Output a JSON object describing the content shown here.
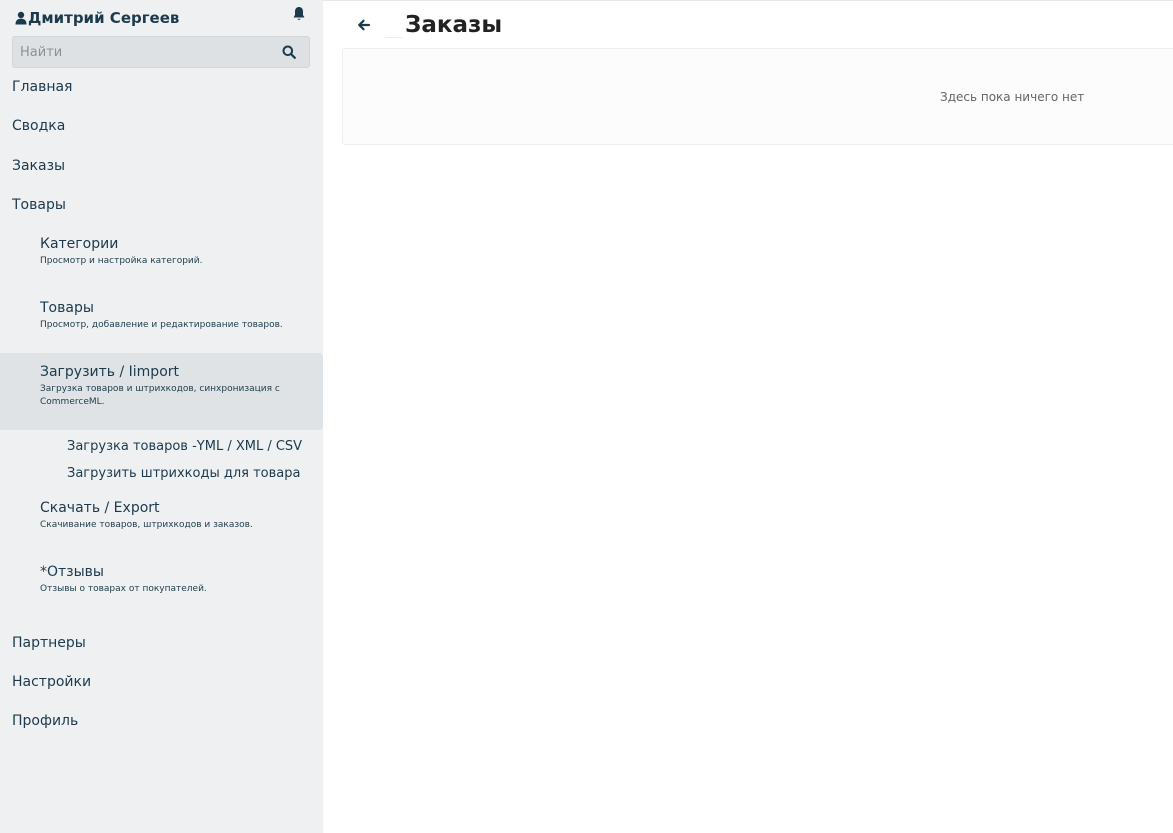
{
  "user": {
    "name": "Дмитрий Сергеев",
    "icon": "user-icon"
  },
  "notifications": {
    "icon": "bell-icon"
  },
  "search": {
    "placeholder": "Найти",
    "value": "",
    "icon": "search-icon"
  },
  "nav": {
    "home": "Главная",
    "summary": "Сводка",
    "orders": "Заказы",
    "products": "Товары",
    "partners": "Партнеры",
    "settings": "Настройки",
    "profile": "Профиль"
  },
  "products_menu": {
    "categories": {
      "title": "Категории",
      "desc": "Просмотр и настройка категорий."
    },
    "goods": {
      "title": "Товары",
      "desc": "Просмотр, добавление и редактирование товаров."
    },
    "import": {
      "title": "Загрузить / Iimport",
      "desc": "Загрузка товаров и штрихкодов, синхронизация с CommerceML."
    },
    "import_sub": {
      "yml": "Загрузка товаров -YML / XML / CSV",
      "barcodes": "Загрузить штрихкоды для товара"
    },
    "export": {
      "title": "Скачать / Export",
      "desc": "Скачивание товаров, штрихкодов и заказов."
    },
    "reviews": {
      "title": "*Отзывы",
      "desc": "Отзывы о товарах от покупателей."
    }
  },
  "main": {
    "back_icon": "arrow-left-icon",
    "title": "Заказы",
    "empty_text": "Здесь пока ничего нет"
  },
  "colors": {
    "sidebar_bg": "#eef0f1",
    "active_bg": "#dfe3e5",
    "text_primary": "#1c3a4c"
  }
}
